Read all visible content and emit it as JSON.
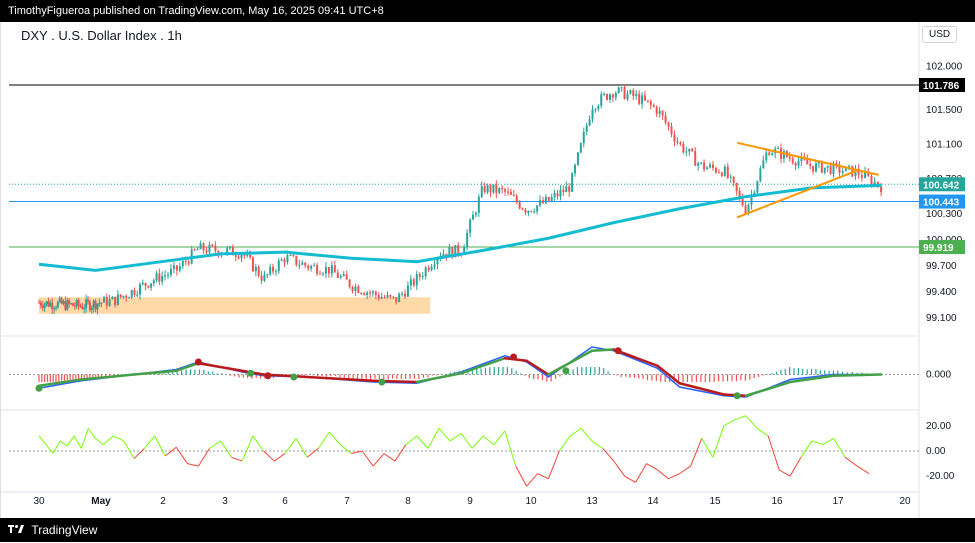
{
  "header": {
    "publisher_text": "TimothyFigueroa published on TradingView.com, May 16, 2025 09:41 UTC+8"
  },
  "footer": {
    "brand": "TradingView",
    "logo": "tradingview-logo-icon"
  },
  "colors": {
    "up": "#26a69a",
    "down": "#ef5350",
    "ma": "#13bcd0",
    "zone": "#ffd59e",
    "triangle": "#ff9800",
    "support_blue": "#2196f3",
    "support_green": "#4caf50",
    "macd_line": "#2962ff",
    "signal_green": "#43a047",
    "signal_red": "#b71c1c",
    "rsi_up": "#76ff03",
    "rsi_down": "#f44336"
  },
  "chart_data": [
    {
      "type": "line",
      "title": "DXY . U.S. Dollar Index . 1h",
      "currency": "USD",
      "x_ticks": [
        "30",
        "May",
        "2",
        "3",
        "6",
        "7",
        "8",
        "9",
        "10",
        "13",
        "14",
        "15",
        "16",
        "17",
        "20"
      ],
      "y_ticks": [
        99.1,
        99.4,
        99.7,
        100.0,
        100.3,
        100.7,
        101.1,
        101.5,
        102.0
      ],
      "ylim": [
        98.94,
        102.12
      ],
      "price_labels": [
        {
          "value": 101.786,
          "label": "101.786",
          "style": "black"
        },
        {
          "value": 100.642,
          "label": "100.642",
          "style": "teal"
        },
        {
          "value": 100.443,
          "label": "100.443",
          "style": "blue"
        },
        {
          "value": 99.919,
          "label": "99.919",
          "style": "green"
        }
      ],
      "horizontal_lines": [
        {
          "value": 101.786,
          "color": "#000000"
        },
        {
          "value": 100.443,
          "color": "#2196f3"
        },
        {
          "value": 99.919,
          "color": "#4caf50"
        }
      ],
      "close_path": [
        [
          0,
          99.28
        ],
        [
          3,
          99.24
        ],
        [
          5,
          99.3
        ],
        [
          6,
          99.42
        ],
        [
          7,
          99.55
        ],
        [
          8,
          99.65
        ],
        [
          9,
          99.9
        ],
        [
          10,
          99.88
        ],
        [
          11,
          99.85
        ],
        [
          12,
          99.55
        ],
        [
          13,
          99.8
        ],
        [
          14,
          99.7
        ],
        [
          15,
          99.66
        ],
        [
          16,
          99.48
        ],
        [
          17,
          99.38
        ],
        [
          18,
          99.3
        ],
        [
          19,
          99.55
        ],
        [
          20,
          99.85
        ],
        [
          21,
          99.88
        ],
        [
          22,
          100.6
        ],
        [
          23,
          100.55
        ],
        [
          24,
          100.35
        ],
        [
          25,
          100.45
        ],
        [
          26,
          100.62
        ],
        [
          27,
          101.55
        ],
        [
          28,
          101.72
        ],
        [
          29,
          101.65
        ],
        [
          30,
          101.5
        ],
        [
          31,
          101.1
        ],
        [
          32,
          100.85
        ],
        [
          33,
          100.8
        ],
        [
          34,
          100.35
        ],
        [
          35,
          101.05
        ],
        [
          36,
          100.95
        ],
        [
          37,
          100.85
        ],
        [
          38,
          100.82
        ],
        [
          39,
          100.78
        ],
        [
          40,
          100.62
        ]
      ],
      "moving_average": [
        [
          0,
          99.72
        ],
        [
          4,
          99.65
        ],
        [
          7,
          99.74
        ],
        [
          10,
          99.84
        ],
        [
          13,
          99.86
        ],
        [
          16,
          99.79
        ],
        [
          19,
          99.75
        ],
        [
          22,
          99.88
        ],
        [
          25,
          100.02
        ],
        [
          28,
          100.2
        ],
        [
          31,
          100.36
        ],
        [
          34,
          100.5
        ],
        [
          37,
          100.6
        ],
        [
          40,
          100.63
        ]
      ],
      "support_zone": {
        "x_start": 0,
        "x_end": 19.6,
        "y_low": 99.15,
        "y_high": 99.34
      },
      "triangle": {
        "upper": [
          [
            33.6,
            101.12
          ],
          [
            39.9,
            100.75
          ]
        ],
        "lower": [
          [
            33.6,
            100.26
          ],
          [
            39.0,
            100.8
          ]
        ]
      },
      "point_to_x_tick_index": [
        [
          0,
          0
        ],
        [
          4.4,
          1
        ],
        [
          7.4,
          2
        ],
        [
          10.2,
          3
        ],
        [
          13.0,
          4
        ],
        [
          15.8,
          5
        ],
        [
          18.6,
          6
        ],
        [
          21.4,
          7
        ],
        [
          24.2,
          8
        ],
        [
          27.0,
          9
        ],
        [
          29.8,
          10
        ],
        [
          32.6,
          11
        ],
        [
          35.4,
          12
        ],
        [
          38.2,
          13
        ],
        [
          41.0,
          14
        ]
      ]
    },
    {
      "type": "line",
      "name": "macd-panel",
      "y_ticks": [
        0.0
      ],
      "ylim": [
        -0.26,
        0.26
      ],
      "macd": [
        [
          0,
          -0.11
        ],
        [
          3,
          -0.05
        ],
        [
          6,
          0.0
        ],
        [
          8,
          0.04
        ],
        [
          9,
          0.1
        ],
        [
          11,
          0.02
        ],
        [
          12,
          -0.01
        ],
        [
          14,
          -0.02
        ],
        [
          17,
          -0.06
        ],
        [
          19,
          -0.07
        ],
        [
          21,
          0.02
        ],
        [
          23,
          0.15
        ],
        [
          24,
          0.1
        ],
        [
          25,
          -0.02
        ],
        [
          27,
          0.22
        ],
        [
          28,
          0.19
        ],
        [
          30,
          0.05
        ],
        [
          31,
          -0.1
        ],
        [
          33,
          -0.17
        ],
        [
          34,
          -0.18
        ],
        [
          36,
          -0.04
        ],
        [
          38,
          0.0
        ],
        [
          40,
          0.0
        ]
      ],
      "signal": [
        [
          0,
          -0.09
        ],
        [
          3,
          -0.04
        ],
        [
          6,
          0.0
        ],
        [
          8,
          0.03
        ],
        [
          9,
          0.09
        ],
        [
          11,
          0.03
        ],
        [
          12,
          0.0
        ],
        [
          14,
          -0.02
        ],
        [
          17,
          -0.05
        ],
        [
          19,
          -0.06
        ],
        [
          21,
          0.01
        ],
        [
          23,
          0.13
        ],
        [
          24,
          0.11
        ],
        [
          25,
          0.0
        ],
        [
          27,
          0.19
        ],
        [
          28,
          0.2
        ],
        [
          30,
          0.07
        ],
        [
          31,
          -0.07
        ],
        [
          33,
          -0.16
        ],
        [
          34,
          -0.17
        ],
        [
          36,
          -0.06
        ],
        [
          38,
          -0.01
        ],
        [
          40,
          0.0
        ]
      ],
      "cross_dots": [
        {
          "x": 0,
          "y": -0.11,
          "kind": "bull"
        },
        {
          "x": 9,
          "y": 0.1,
          "kind": "bear"
        },
        {
          "x": 11.4,
          "y": 0.01,
          "kind": "bull"
        },
        {
          "x": 12.2,
          "y": -0.01,
          "kind": "bear"
        },
        {
          "x": 13.4,
          "y": -0.02,
          "kind": "bull"
        },
        {
          "x": 17.4,
          "y": -0.06,
          "kind": "bull"
        },
        {
          "x": 23.4,
          "y": 0.14,
          "kind": "bear"
        },
        {
          "x": 25.8,
          "y": 0.03,
          "kind": "bull"
        },
        {
          "x": 28.2,
          "y": 0.19,
          "kind": "bear"
        },
        {
          "x": 33.6,
          "y": -0.17,
          "kind": "bull"
        }
      ]
    },
    {
      "type": "line",
      "name": "oscillator-panel",
      "y_ticks": [
        20.0,
        0.0,
        -20.0
      ],
      "ylim": [
        -31,
        31
      ],
      "values": [
        [
          0,
          12
        ],
        [
          0.5,
          5
        ],
        [
          1,
          -2
        ],
        [
          1.5,
          8
        ],
        [
          2,
          4
        ],
        [
          2.5,
          12
        ],
        [
          3,
          2
        ],
        [
          3.5,
          18
        ],
        [
          4,
          10
        ],
        [
          4.5,
          5
        ],
        [
          5,
          12
        ],
        [
          5.5,
          8
        ],
        [
          6,
          -6
        ],
        [
          6.5,
          2
        ],
        [
          7,
          12
        ],
        [
          7.5,
          -4
        ],
        [
          8,
          3
        ],
        [
          8.5,
          -10
        ],
        [
          9,
          -12
        ],
        [
          9.5,
          2
        ],
        [
          10,
          8
        ],
        [
          10.5,
          -5
        ],
        [
          11,
          -8
        ],
        [
          11.5,
          12
        ],
        [
          12,
          0
        ],
        [
          12.5,
          -8
        ],
        [
          13,
          -2
        ],
        [
          13.5,
          10
        ],
        [
          14,
          -5
        ],
        [
          14.5,
          2
        ],
        [
          15,
          15
        ],
        [
          15.5,
          5
        ],
        [
          16,
          -2
        ],
        [
          16.5,
          0
        ],
        [
          17,
          -12
        ],
        [
          17.5,
          -2
        ],
        [
          18,
          -8
        ],
        [
          18.5,
          5
        ],
        [
          19,
          12
        ],
        [
          19.5,
          2
        ],
        [
          20,
          18
        ],
        [
          20.5,
          8
        ],
        [
          21,
          14
        ],
        [
          21.5,
          2
        ],
        [
          22,
          12
        ],
        [
          22.5,
          5
        ],
        [
          23,
          16
        ],
        [
          23.5,
          -12
        ],
        [
          24,
          -28
        ],
        [
          24.5,
          -18
        ],
        [
          25,
          -22
        ],
        [
          25.5,
          0
        ],
        [
          26,
          12
        ],
        [
          26.5,
          18
        ],
        [
          27,
          8
        ],
        [
          27.5,
          2
        ],
        [
          28,
          -8
        ],
        [
          28.5,
          -20
        ],
        [
          29,
          -25
        ],
        [
          29.5,
          -10
        ],
        [
          30,
          -15
        ],
        [
          30.5,
          -22
        ],
        [
          31,
          -18
        ],
        [
          31.5,
          -12
        ],
        [
          32,
          10
        ],
        [
          32.5,
          -5
        ],
        [
          33,
          20
        ],
        [
          33.5,
          25
        ],
        [
          34,
          28
        ],
        [
          34.5,
          18
        ],
        [
          35,
          12
        ],
        [
          35.5,
          -15
        ],
        [
          36,
          -20
        ],
        [
          36.5,
          -5
        ],
        [
          37,
          8
        ],
        [
          37.5,
          5
        ],
        [
          38,
          10
        ],
        [
          38.5,
          -5
        ],
        [
          39,
          -12
        ],
        [
          39.5,
          -18
        ]
      ]
    }
  ]
}
